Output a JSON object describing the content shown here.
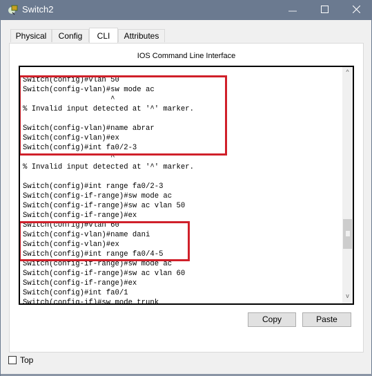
{
  "window": {
    "title": "Switch2",
    "app_icon": "packet-tracer-switch-icon",
    "controls": {
      "minimize": "minimize-icon",
      "maximize": "maximize-icon",
      "close": "close-icon",
      "minimize_glyph": "—",
      "maximize_glyph": "☐",
      "close_glyph": "✕"
    }
  },
  "tabs": [
    {
      "label": "Physical",
      "active": false
    },
    {
      "label": "Config",
      "active": false
    },
    {
      "label": "CLI",
      "active": true
    },
    {
      "label": "Attributes",
      "active": false
    }
  ],
  "panel": {
    "title": "IOS Command Line Interface"
  },
  "console": {
    "lines": [
      "Switch(config)#vlan 50",
      "Switch(config-vlan)#sw mode ac",
      "                    ^",
      "% Invalid input detected at '^' marker.",
      "",
      "Switch(config-vlan)#name abrar",
      "Switch(config-vlan)#ex",
      "Switch(config)#int fa0/2-3",
      "                    ^",
      "% Invalid input detected at '^' marker.",
      "",
      "Switch(config)#int range fa0/2-3",
      "Switch(config-if-range)#sw mode ac",
      "Switch(config-if-range)#sw ac vlan 50",
      "Switch(config-if-range)#ex",
      "Switch(config)#vlan 60",
      "Switch(config-vlan)#name dani",
      "Switch(config-vlan)#ex",
      "Switch(config)#int range fa0/4-5",
      "Switch(config-if-range)#sw mode ac",
      "Switch(config-if-range)#sw ac vlan 60",
      "Switch(config-if-range)#ex",
      "Switch(config)#int fa0/1",
      "Switch(config-if)#sw mode trunk"
    ],
    "highlight_color": "#d0202a",
    "scroll_up_glyph": "^",
    "scroll_down_glyph": "v"
  },
  "buttons": {
    "copy": "Copy",
    "paste": "Paste"
  },
  "footer": {
    "top_checkbox_label": "Top",
    "top_checked": false
  }
}
